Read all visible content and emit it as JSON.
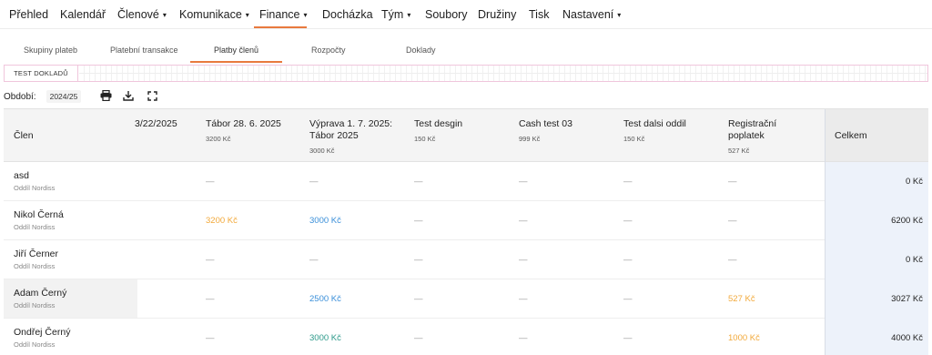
{
  "nav": {
    "items": [
      {
        "label": "Přehled",
        "caret": false
      },
      {
        "label": "Kalendář",
        "caret": false
      },
      {
        "label": "Členové",
        "caret": true
      },
      {
        "label": "Komunikace",
        "caret": true
      },
      {
        "label": "Finance",
        "caret": true,
        "active": true
      },
      {
        "label": "Docházka",
        "caret": false
      },
      {
        "label": "Tým",
        "caret": true
      },
      {
        "label": "Soubory",
        "caret": false
      },
      {
        "label": "Družiny",
        "caret": false
      },
      {
        "label": "Tisk",
        "caret": false
      },
      {
        "label": "Nastavení",
        "caret": true
      }
    ],
    "caret_glyph": "▾"
  },
  "subtabs": [
    {
      "label": "Skupiny plateb"
    },
    {
      "label": "Platební transakce"
    },
    {
      "label": "Platby členů",
      "active": true
    },
    {
      "label": "Rozpočty"
    },
    {
      "label": "Doklady"
    }
  ],
  "groupbar": {
    "active_label": "TEST DOKLADŮ"
  },
  "period": {
    "label": "Období:",
    "value": "2024/25"
  },
  "toolbar": {
    "print_icon": "printer-icon",
    "download_icon": "download-icon",
    "fullscreen_icon": "fullscreen-icon"
  },
  "table": {
    "member_header": "Člen",
    "total_header": "Celkem",
    "columns": [
      {
        "title": "3/22/2025",
        "price": ""
      },
      {
        "title": "Tábor 28. 6. 2025",
        "price": "3200 Kč"
      },
      {
        "title": "Výprava 1. 7. 2025:",
        "title2": "Tábor 2025",
        "price": "3000 Kč"
      },
      {
        "title": "Test desgin",
        "price": "150 Kč"
      },
      {
        "title": "Cash test 03",
        "price": "999 Kč"
      },
      {
        "title": "Test dalsi oddil",
        "price": "150 Kč"
      },
      {
        "title": "Registrační",
        "title2": "poplatek",
        "price": "527 Kč"
      }
    ],
    "rows": [
      {
        "name": "asd",
        "group": "Oddíl Nordiss",
        "cells": [
          "",
          "—",
          "—",
          "—",
          "—",
          "—",
          "—"
        ],
        "total": "0 Kč"
      },
      {
        "name": "Nikol Černá",
        "group": "Oddíl Nordiss",
        "cells": [
          "",
          "3200 Kč",
          "3000 Kč",
          "—",
          "—",
          "—",
          "—"
        ],
        "total": "6200 Kč"
      },
      {
        "name": "Jiří Černer",
        "group": "Oddíl Nordiss",
        "cells": [
          "",
          "—",
          "—",
          "—",
          "—",
          "—",
          "—"
        ],
        "total": "0 Kč"
      },
      {
        "name": "Adam Černý",
        "group": "Oddíl Nordiss",
        "cells": [
          "",
          "—",
          "2500 Kč",
          "—",
          "—",
          "—",
          "527 Kč"
        ],
        "total": "3027 Kč"
      },
      {
        "name": "Ondřej Černý",
        "group": "Oddíl Nordiss",
        "cells": [
          "",
          "—",
          "3000 Kč",
          "—",
          "—",
          "—",
          "1000 Kč"
        ],
        "total": "4000 Kč"
      }
    ]
  },
  "colors": {
    "accent": "#e87a3e",
    "amber": "#f2a93b",
    "blue": "#3a8fd9",
    "teal": "#2d9a8a"
  }
}
